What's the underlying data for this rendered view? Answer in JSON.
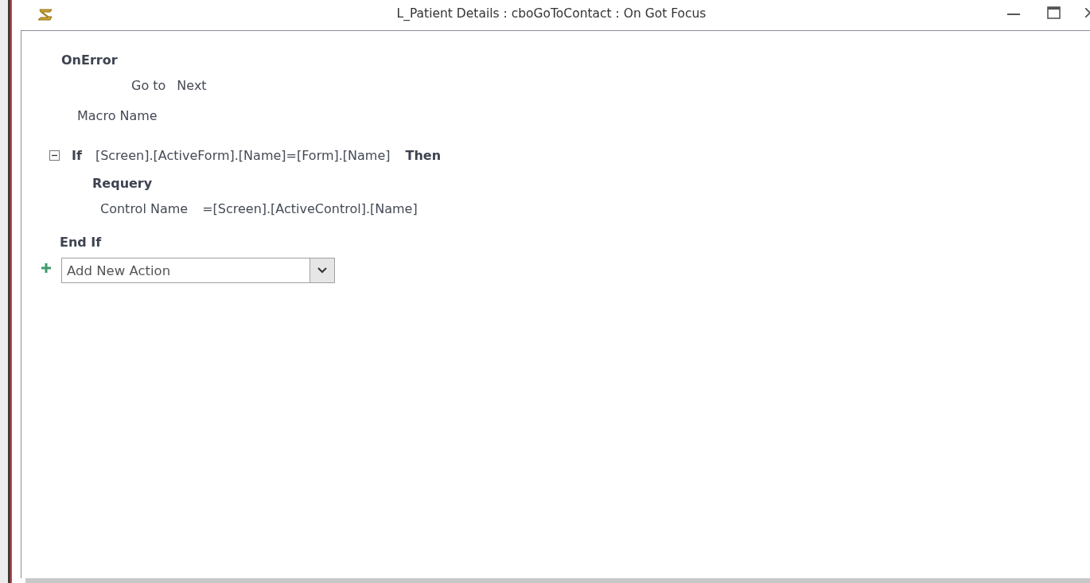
{
  "window": {
    "title": "L_Patient Details : cboGoToContact : On Got Focus"
  },
  "on_error": {
    "action": "OnError",
    "arguments": [
      {
        "name": "Go to",
        "value": "Next"
      },
      {
        "name": "Macro Name"
      }
    ]
  },
  "if_block": {
    "expanded": true,
    "keyword": "If",
    "condition": "[Screen].[ActiveForm].[Name]=[Form].[Name]",
    "then": "Then",
    "action": "Requery",
    "arguments": [
      {
        "name": "Control Name",
        "value": "=[Screen].[ActiveControl].[Name]"
      }
    ],
    "end": "End If"
  },
  "add_action": {
    "placeholder": "Add New Action"
  }
}
